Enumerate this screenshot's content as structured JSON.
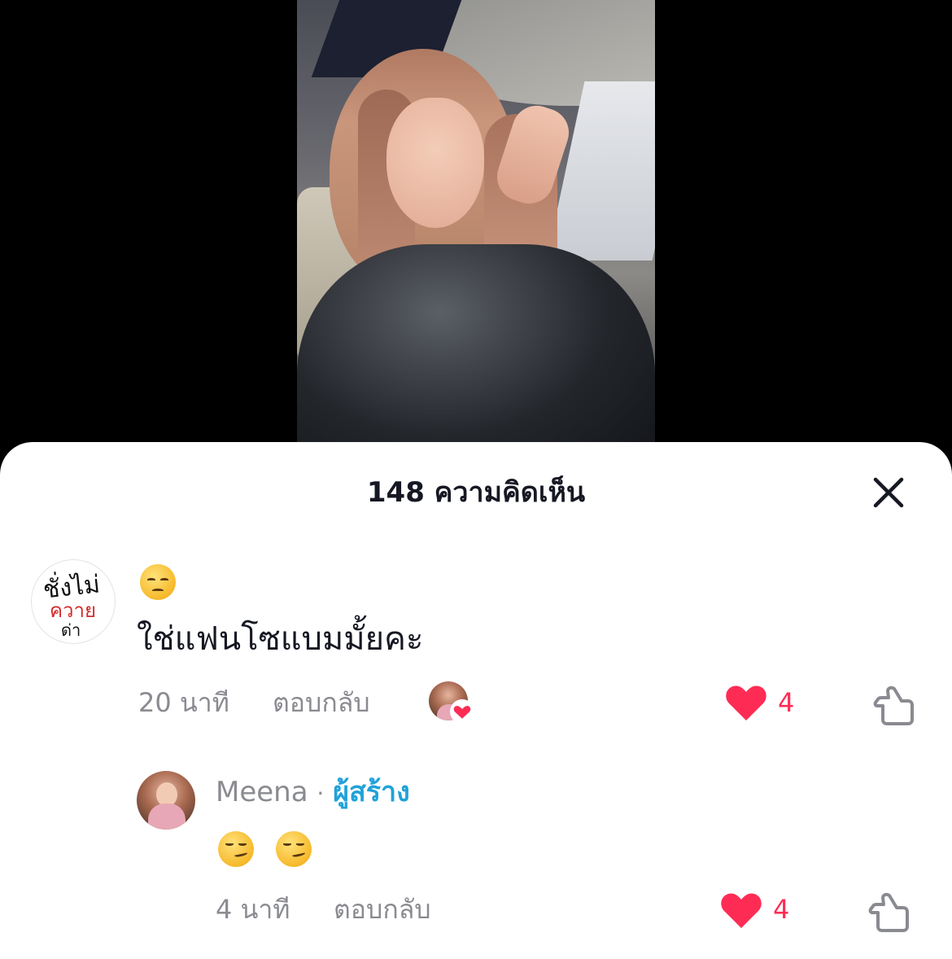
{
  "sheet": {
    "title": "148 ความคิดเห็น"
  },
  "comments": [
    {
      "avatar_text": [
        "ชั่งไม่",
        "ควาย",
        "ด่า"
      ],
      "emoji": "pensive-face",
      "text": "ใช่แฟนโซแบมมั้ยคะ",
      "time": "20 นาที",
      "reply_label": "ตอบกลับ",
      "likes": "4",
      "liked_by_creator": true
    }
  ],
  "replies": [
    {
      "author": "Meena",
      "separator": "·",
      "author_tag": "ผู้สร้าง",
      "emojis": [
        "smirking-face",
        "smirking-face"
      ],
      "time": "4 นาที",
      "reply_label": "ตอบกลับ",
      "likes": "4"
    }
  ],
  "colors": {
    "like": "#fe2c55",
    "creator": "#20a2d9",
    "muted": "#8a8b91",
    "text": "#161823"
  }
}
